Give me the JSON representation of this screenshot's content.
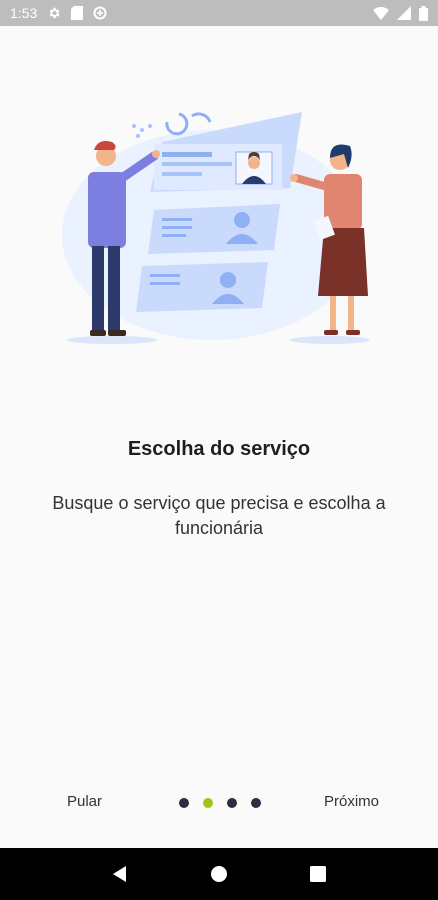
{
  "status_bar": {
    "time": "1:53",
    "left_icons": [
      "settings-icon",
      "sd-card-icon",
      "data-saver-icon"
    ],
    "right_icons": [
      "wifi-icon",
      "cell-signal-icon",
      "battery-icon"
    ]
  },
  "onboarding": {
    "title": "Escolha do serviço",
    "description": "Busque o serviço que precisa e escolha a funcionária",
    "page_count": 4,
    "active_page": 2
  },
  "nav": {
    "skip_label": "Pular",
    "next_label": "Próximo"
  },
  "colors": {
    "accent": "#9cc41b",
    "dot_inactive": "#2b2e3c",
    "status_bar": "#bdbdbd"
  },
  "system_nav": [
    "back-icon",
    "home-icon",
    "recents-icon"
  ]
}
